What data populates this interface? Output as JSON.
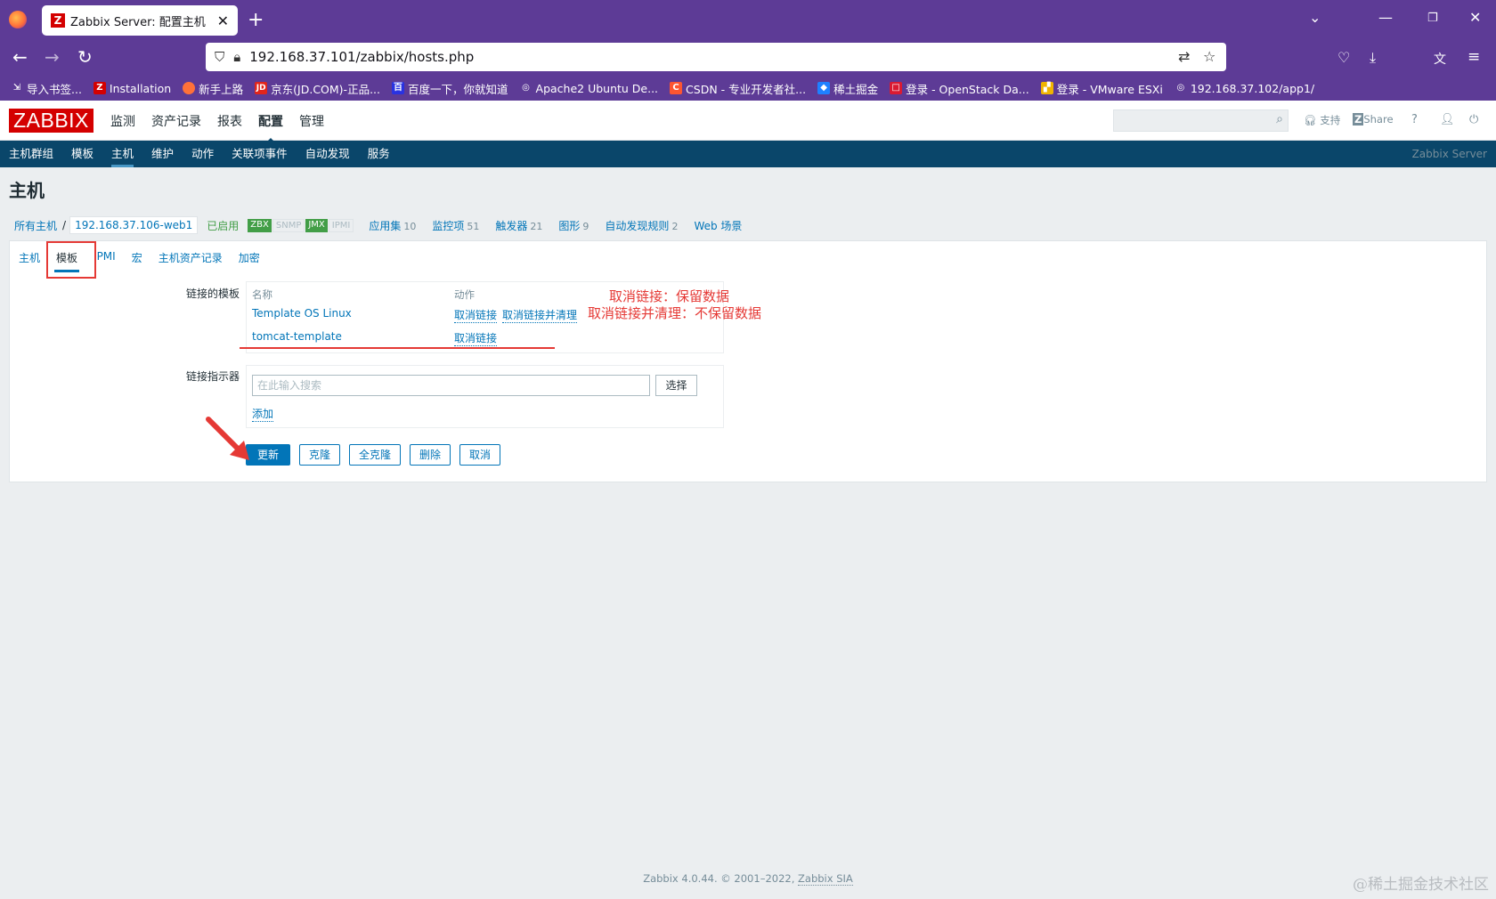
{
  "browser": {
    "tab_title": "Zabbix Server: 配置主机",
    "tab_favicon": "Z",
    "url": "192.168.37.101/zabbix/hosts.php",
    "bookmarks": [
      {
        "icon": "import-icon",
        "label": "导入书签..."
      },
      {
        "icon": "zabbix-icon",
        "label": "Installation"
      },
      {
        "icon": "firefox-icon",
        "label": "新手上路"
      },
      {
        "icon": "jd-icon",
        "label": "京东(JD.COM)-正品..."
      },
      {
        "icon": "baidu-icon",
        "label": "百度一下，你就知道"
      },
      {
        "icon": "globe-icon",
        "label": "Apache2 Ubuntu De..."
      },
      {
        "icon": "csdn-icon",
        "label": "CSDN - 专业开发者社..."
      },
      {
        "icon": "juejin-icon",
        "label": "稀土掘金"
      },
      {
        "icon": "openstack-icon",
        "label": "登录 - OpenStack Da..."
      },
      {
        "icon": "vmware-icon",
        "label": "登录 - VMware ESXi"
      },
      {
        "icon": "globe-icon",
        "label": "192.168.37.102/app1/"
      }
    ]
  },
  "zabbix": {
    "logo": "ZABBIX",
    "main_menu": [
      "监测",
      "资产记录",
      "报表",
      "配置",
      "管理"
    ],
    "main_menu_active": "配置",
    "header_links": {
      "support": "支持",
      "share": "Share",
      "help": "?"
    },
    "sub_menu": [
      "主机群组",
      "模板",
      "主机",
      "维护",
      "动作",
      "关联项事件",
      "自动发现",
      "服务"
    ],
    "sub_menu_active": "主机",
    "server_name": "Zabbix Server"
  },
  "page": {
    "title": "主机",
    "breadcrumb": {
      "all_hosts": "所有主机",
      "separator": "/",
      "host": "192.168.37.106-web1"
    },
    "status": "已启用",
    "availability": [
      {
        "label": "ZBX",
        "on": true
      },
      {
        "label": "SNMP",
        "on": false
      },
      {
        "label": "JMX",
        "on": true
      },
      {
        "label": "IPMI",
        "on": false
      }
    ],
    "host_links": [
      {
        "label": "应用集",
        "count": "10"
      },
      {
        "label": "监控项",
        "count": "51"
      },
      {
        "label": "触发器",
        "count": "21"
      },
      {
        "label": "图形",
        "count": "9"
      },
      {
        "label": "自动发现规则",
        "count": "2"
      },
      {
        "label": "Web 场景",
        "count": ""
      }
    ],
    "form_tabs": [
      "主机",
      "模板",
      "IPMI",
      "宏",
      "主机资产记录",
      "加密"
    ],
    "form_tab_active": "模板",
    "linked_templates_label": "链接的模板",
    "table_headers": {
      "name": "名称",
      "action": "动作"
    },
    "linked_templates": [
      {
        "name": "Template OS Linux",
        "unlink": "取消链接",
        "unlink_clear": "取消链接并清理"
      },
      {
        "name": "tomcat-template",
        "unlink": "取消链接",
        "unlink_clear": ""
      }
    ],
    "annotation": {
      "line1": "取消链接：保留数据",
      "line2": "取消链接并清理：不保留数据"
    },
    "link_indicator_label": "链接指示器",
    "search_placeholder": "在此输入搜索",
    "select_button": "选择",
    "add_link": "添加",
    "buttons": {
      "update": "更新",
      "clone": "克隆",
      "full_clone": "全克隆",
      "delete": "删除",
      "cancel": "取消"
    }
  },
  "footer": {
    "text": "Zabbix 4.0.44. © 2001–2022, ",
    "company": "Zabbix SIA"
  },
  "watermark": "@稀土掘金技术社区",
  "colors": {
    "browser_purple": "#5d3b96",
    "zabbix_red": "#d40000",
    "submenu_blue": "#0a466a",
    "link_blue": "#0275b8",
    "annotation_red": "#e53935",
    "enabled_green": "#429e47"
  }
}
